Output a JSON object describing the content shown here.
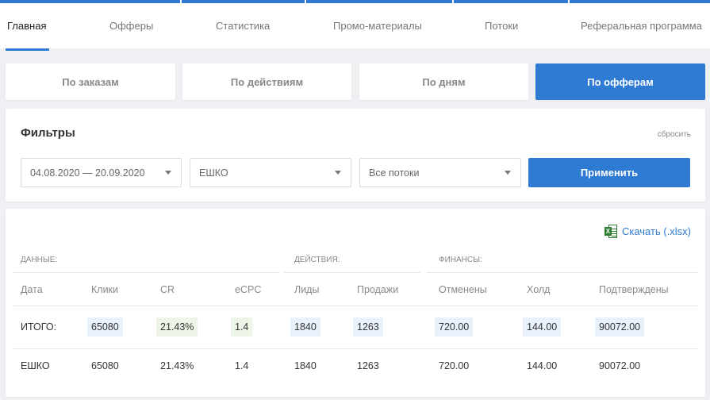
{
  "nav": {
    "items": [
      "Главная",
      "Офферы",
      "Статистика",
      "Промо-материалы",
      "Потоки",
      "Реферальная программа"
    ]
  },
  "modes": [
    "По заказам",
    "По действиям",
    "По дням",
    "По офферам"
  ],
  "filters": {
    "title": "Фильтры",
    "reset": "сбросить",
    "date_range": "04.08.2020 — 20.09.2020",
    "offer": "ЕШКО",
    "streams": "Все потоки",
    "apply": "Применить"
  },
  "table": {
    "download": "Скачать (.xlsx)",
    "groups": [
      "ДАННЫЕ:",
      "ДЕЙСТВИЯ:",
      "ФИНАНСЫ:"
    ],
    "columns": [
      "Дата",
      "Клики",
      "CR",
      "eCPC",
      "Лиды",
      "Продажи",
      "Отменены",
      "Холд",
      "Подтверждены"
    ],
    "total": {
      "label": "ИТОГО:",
      "values": [
        "65080",
        "21.43%",
        "1.4",
        "1840",
        "1263",
        "720.00",
        "144.00",
        "90072.00"
      ]
    },
    "rows": [
      {
        "label": "ЕШКО",
        "values": [
          "65080",
          "21.43%",
          "1.4",
          "1840",
          "1263",
          "720.00",
          "144.00",
          "90072.00"
        ]
      }
    ]
  },
  "colors": {
    "accent": "#2f7bd3",
    "highlight_blue": "#e8f1fc",
    "highlight_green": "#ecf5e8",
    "excel_green": "#2e7d32"
  }
}
